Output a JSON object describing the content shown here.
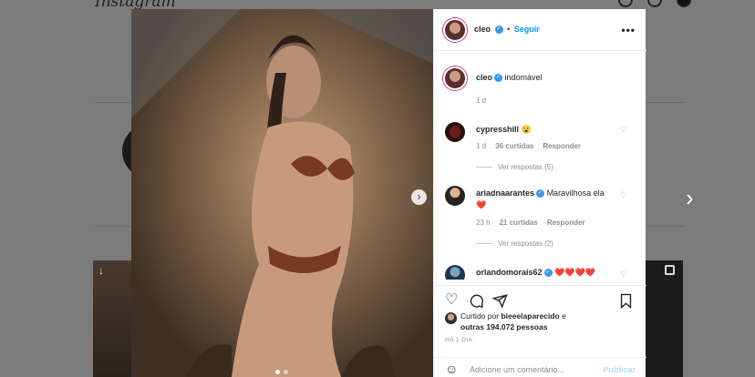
{
  "background": {
    "logo": "Instagram"
  },
  "post": {
    "author": "cleo",
    "verified": true,
    "follow_label": "Seguir",
    "more_label": "•••",
    "caption": {
      "username": "cleo",
      "text": "indomável",
      "age": "1 d"
    },
    "comments": [
      {
        "username": "cypresshill",
        "text": "😮",
        "age": "1 d",
        "likes": "36 curtidas",
        "reply": "Responder",
        "view_replies": "Ver respostas (5)"
      },
      {
        "username": "ariadnaarantes",
        "text": "Maravilhosa ela ❤️",
        "age": "23 h",
        "likes": "21 curtidas",
        "reply": "Responder",
        "view_replies": "Ver respostas (2)"
      },
      {
        "username": "orlandomorais62",
        "text": "❤️❤️❤️❤️"
      }
    ],
    "liked_by_prefix": "Curtido por",
    "liked_by_user": "bieeelaparecido",
    "liked_by_and": "e",
    "liked_by_others": "outras 194.072 pessoas",
    "timestamp": "HÁ 1 DIA",
    "comment_placeholder": "Adicione um comentário...",
    "post_label": "Publicar"
  },
  "icons": {
    "verified": "verified-badge-icon",
    "heart": "heart-icon",
    "comment": "comment-icon",
    "share": "share-icon",
    "save": "bookmark-icon",
    "emoji": "emoji-icon",
    "next": "chevron-right-icon"
  },
  "colors": {
    "accent": "#0095f6",
    "liked_red": "#ed4956"
  }
}
